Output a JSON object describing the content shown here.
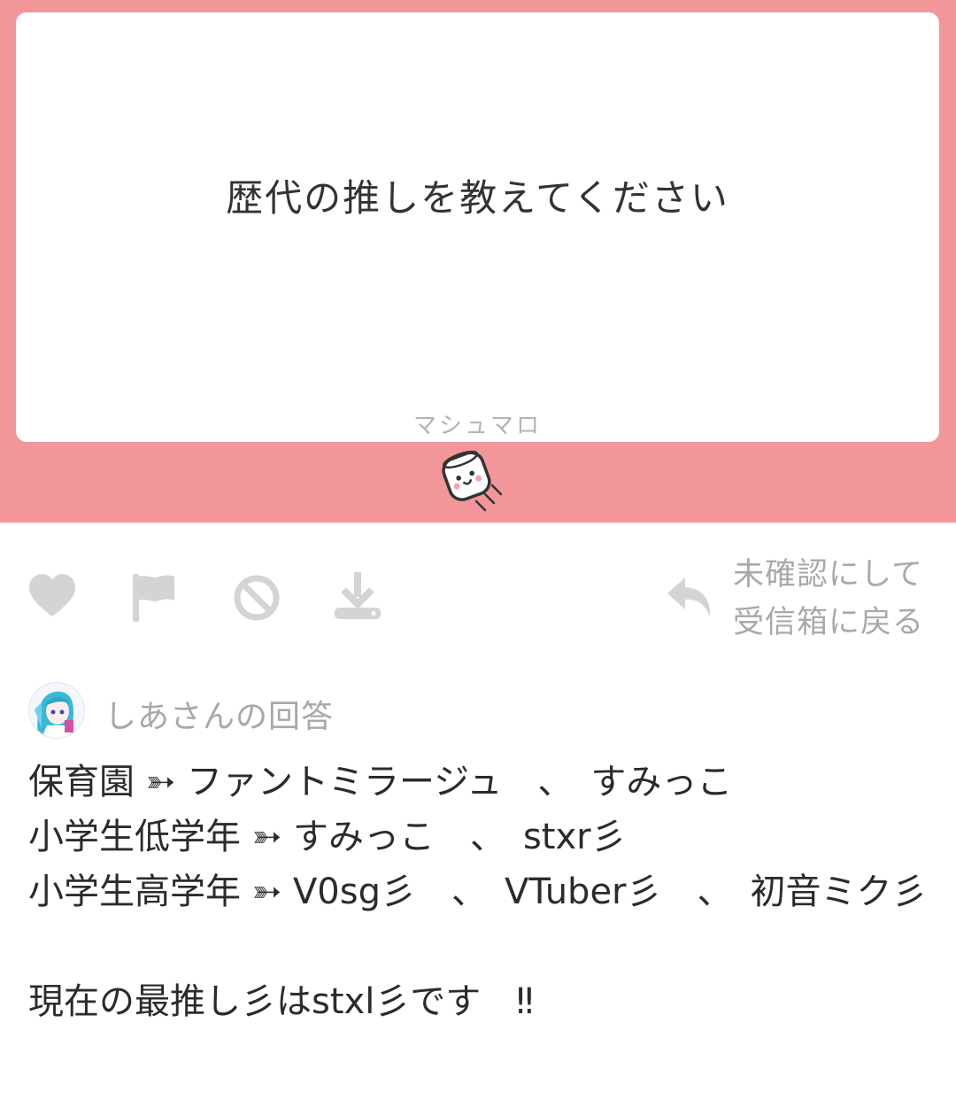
{
  "question": {
    "text": "歴代の推しを教えてください",
    "brand": "マシュマロ"
  },
  "colors": {
    "banner": "#f2969a",
    "icon": "#d4d4d4",
    "muted_text": "#a9a9a9"
  },
  "actions": {
    "icons": [
      "heart-icon",
      "flag-icon",
      "block-icon",
      "download-icon",
      "undo-icon"
    ],
    "undo_label_line1": "未確認にして",
    "undo_label_line2": "受信箱に戻る"
  },
  "answer": {
    "title": "しあさんの回答",
    "lines": [
      "保育園 ➳ ファントミラージュ　、　すみっこ",
      "小学生低学年 ➳ すみっこ　、　stxr彡",
      "小学生高学年 ➳ V0sg彡　、　VTuber彡　、　初音ミク彡",
      "",
      "現在の最推し彡はstxl彡です　‼"
    ]
  }
}
